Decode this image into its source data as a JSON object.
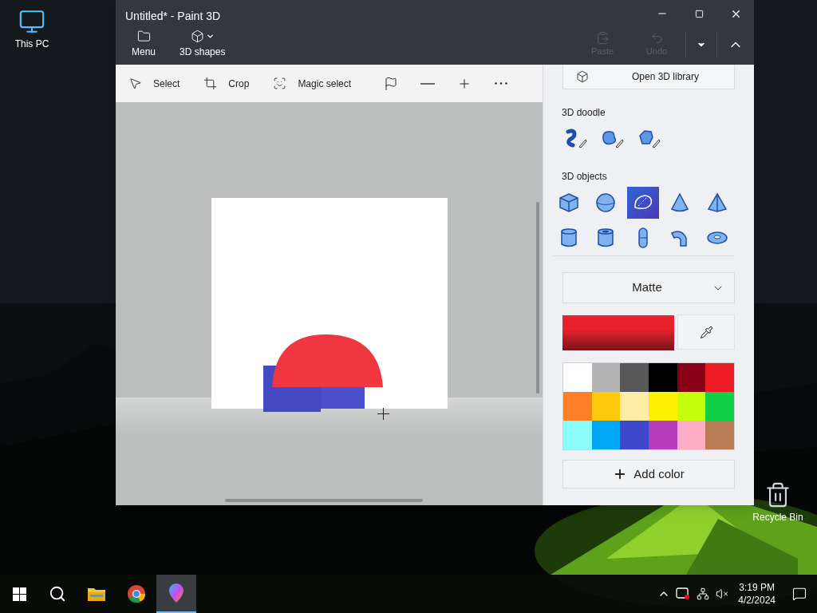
{
  "desktop_icons": [
    {
      "kind": "computer",
      "label": "This PC"
    },
    {
      "kind": "recycle",
      "label": "Recycle Bin"
    }
  ],
  "window": {
    "title": "Untitled* - Paint 3D"
  },
  "ribbon": [
    {
      "kind": "folder",
      "label": "Menu",
      "disabled": false
    },
    {
      "kind": "cube",
      "label": "3D shapes",
      "disabled": false
    }
  ],
  "quick_actions": [
    {
      "kind": "paste",
      "label": "Paste",
      "disabled": true
    },
    {
      "kind": "undo",
      "label": "Undo",
      "disabled": true
    }
  ],
  "toolbar": [
    {
      "kind": "select",
      "label": "Select"
    },
    {
      "kind": "crop",
      "label": "Crop"
    },
    {
      "kind": "magic",
      "label": "Magic select"
    },
    {
      "kind": "flag"
    },
    {
      "kind": "minus"
    },
    {
      "kind": "plus"
    },
    {
      "kind": "more"
    }
  ],
  "panel": {
    "library_button": "Open 3D library",
    "doodle_heading": "3D doodle",
    "doodles": [
      {
        "kind": "tube",
        "selected": false
      },
      {
        "kind": "soft",
        "selected": false
      },
      {
        "kind": "sharp",
        "selected": false
      }
    ],
    "objects_heading": "3D objects",
    "objects": [
      {
        "kind": "cube",
        "selected": false
      },
      {
        "kind": "sphere",
        "selected": false
      },
      {
        "kind": "hemisphere",
        "selected": true
      },
      {
        "kind": "cone",
        "selected": false
      },
      {
        "kind": "pyramid",
        "selected": false
      },
      {
        "kind": "cylinder",
        "selected": false
      },
      {
        "kind": "tube",
        "selected": false
      },
      {
        "kind": "capsule",
        "selected": false
      },
      {
        "kind": "bend",
        "selected": false
      },
      {
        "kind": "torus",
        "selected": false
      }
    ],
    "material": "Matte",
    "current_swatch": {
      "color": "#e8222c"
    },
    "palette": [
      {
        "color": "#ffffff"
      },
      {
        "color": "#b4b4b4"
      },
      {
        "color": "#585858"
      },
      {
        "color": "#000000"
      },
      {
        "color": "#880015"
      },
      {
        "color": "#ed1c24"
      },
      {
        "color": "#ff7f27"
      },
      {
        "color": "#ffc90e"
      },
      {
        "color": "#fdeca6"
      },
      {
        "color": "#fff200"
      },
      {
        "color": "#c4ff0e"
      },
      {
        "color": "#0ed145"
      },
      {
        "color": "#8cfffb"
      },
      {
        "color": "#00a8f3"
      },
      {
        "color": "#3f48cc"
      },
      {
        "color": "#b83dba"
      },
      {
        "color": "#ffaec8"
      },
      {
        "color": "#b97a56"
      }
    ],
    "add_color": "Add color"
  },
  "taskbar": {
    "apps": [
      {
        "kind": "explorer",
        "selected": false
      },
      {
        "kind": "chrome",
        "selected": false
      },
      {
        "kind": "paint3d",
        "selected": true
      }
    ],
    "time": "3:19 PM",
    "date": "4/2/2024"
  }
}
